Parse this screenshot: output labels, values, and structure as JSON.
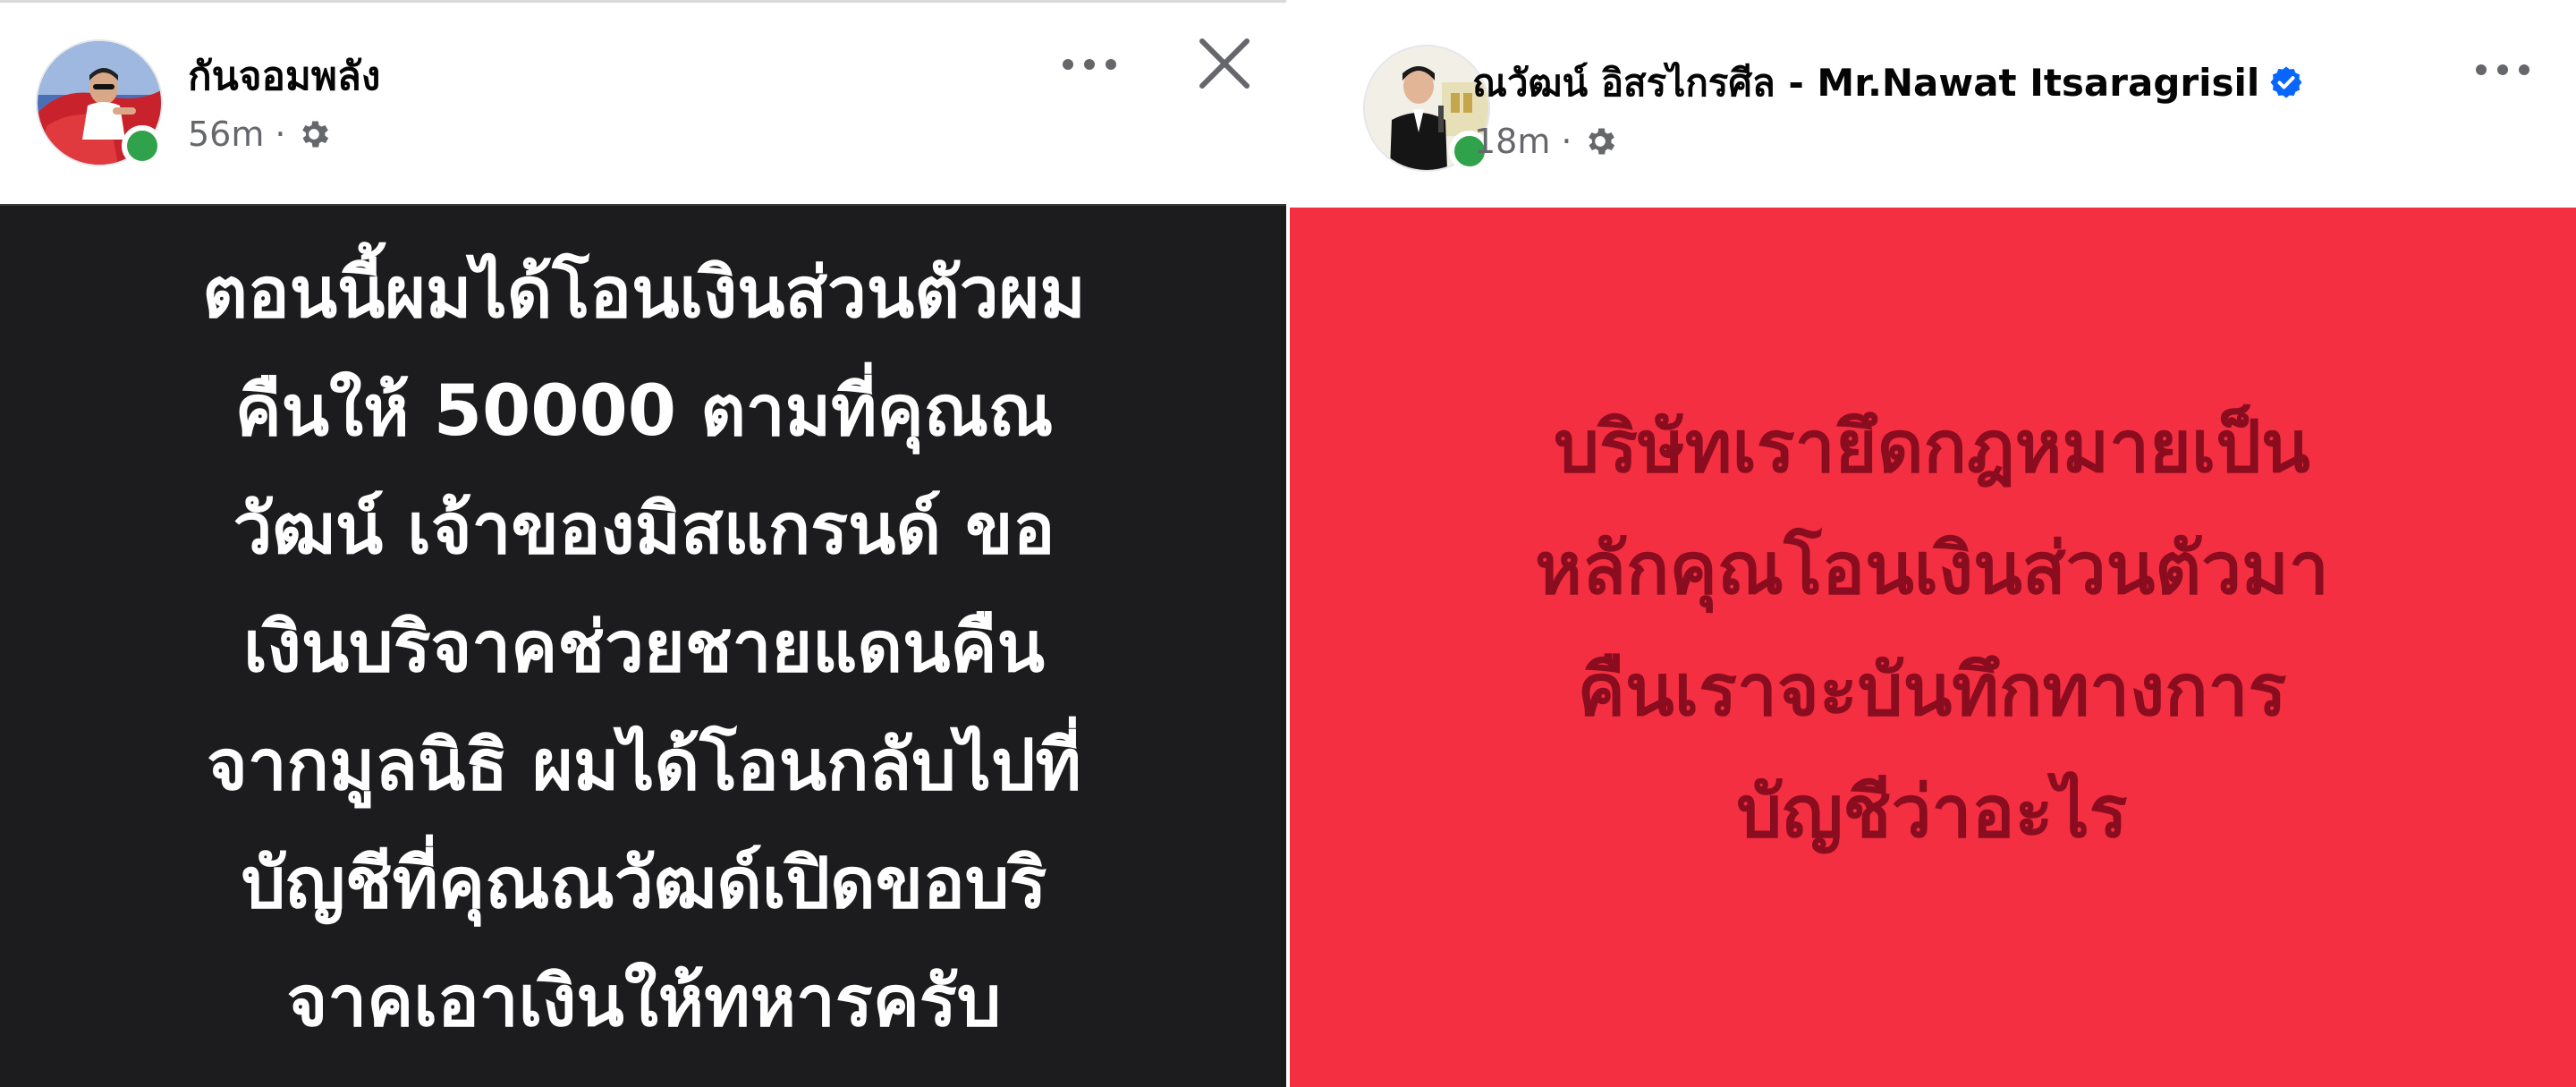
{
  "left_post": {
    "author": "กันจอมพลัง",
    "time": "56m",
    "separator": "·",
    "privacy_icon": "gear-icon",
    "text": "ตอนนี้ผมได้โอนเงินส่วนตัวผม\nคืนให้ 50000 ตามที่คุณณ\nวัฒน์ เจ้าของมิสแกรนด์ ขอ\nเงินบริจาคช่วยชายแดนคืน\nจากมูลนิธิ ผมได้โอนกลับไปที่\nบัญชีที่คุณณวัฒด์เปิดขอบริ\nจาคเอาเงินให้ทหารครับ",
    "background_color": "#1c1c1e",
    "text_color": "#ffffff"
  },
  "right_post": {
    "author": "ณวัฒน์ อิสรไกรศีล - Mr.Nawat Itsaragrisil",
    "verified": true,
    "time": "18m",
    "separator": "·",
    "privacy_icon": "gear-icon",
    "text": "บริษัทเรายึดกฎหมายเป็น\nหลักคุณโอนเงินส่วนตัวมา\nคืนเราจะบันทึกทางการ\nบัญชีว่าอะไร",
    "background_color": "#f52f42",
    "text_color": "#8a0d1f"
  },
  "colors": {
    "online": "#31a24c",
    "verified_badge": "#0866ff",
    "meta_text": "#65676b"
  }
}
